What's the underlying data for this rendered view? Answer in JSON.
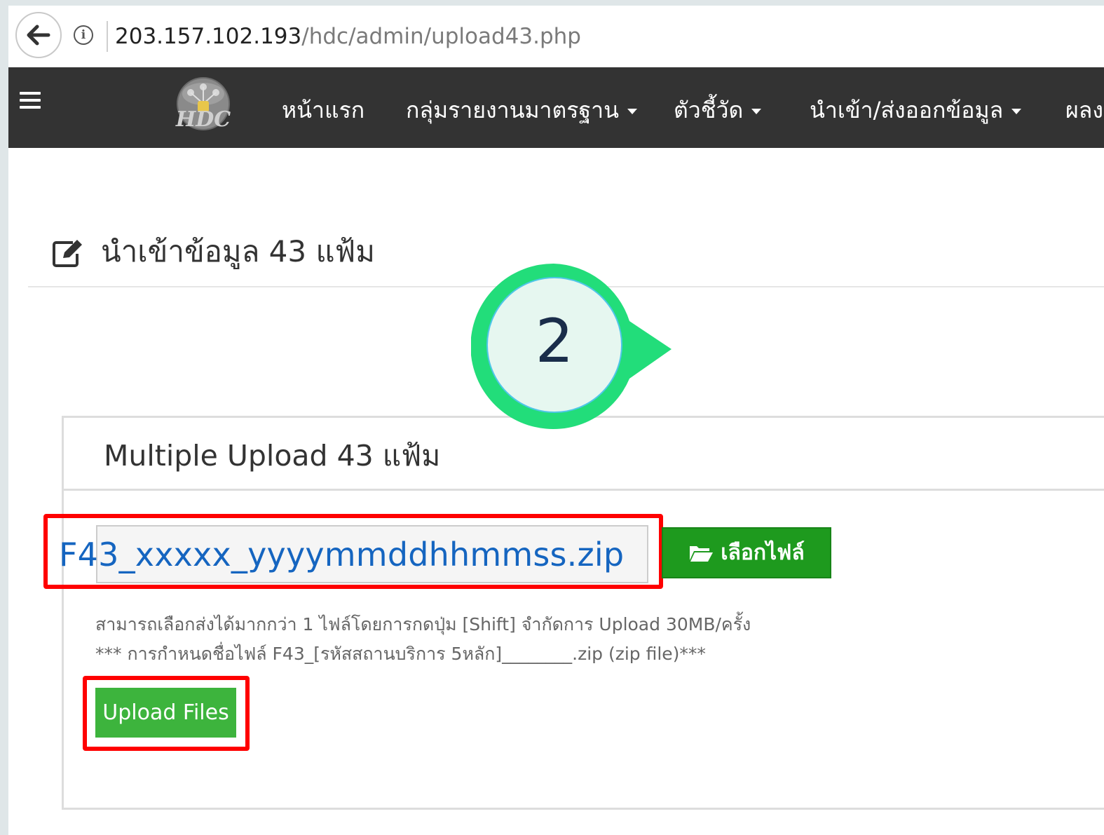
{
  "browser": {
    "url_host": "203.157.102.193",
    "url_path": "/hdc/admin/upload43.php"
  },
  "navbar": {
    "items": [
      {
        "label": "หน้าแรก",
        "dropdown": false
      },
      {
        "label": "กลุ่มรายงานมาตรฐาน",
        "dropdown": true
      },
      {
        "label": "ตัวชี้วัด",
        "dropdown": true
      },
      {
        "label": "นำเข้า/ส่งออกข้อมูล",
        "dropdown": true
      },
      {
        "label": "ผลง",
        "dropdown": false
      }
    ],
    "logo_text": "HDC"
  },
  "page": {
    "title": "นำเข้าข้อมูล 43 แฟ้ม"
  },
  "panel": {
    "title": "Multiple Upload 43 แฟ้ม",
    "file_name": "F43_xxxxx_yyyymmddhhmmss.zip",
    "choose_label": "เลือกไฟล์",
    "help_line1": "สามารถเลือกส่งได้มากกว่า 1 ไฟล์โดยการกดปุ่ม [Shift] จำกัดการ Upload 30MB/ครั้ง",
    "help_line2": "*** การกำหนดชื่อไฟล์ F43_[รหัสสถานบริการ 5หลัก]________.zip (zip file)***",
    "upload_label": "Upload Files"
  },
  "annotation": {
    "step_number": "2",
    "colors": {
      "highlight": "#ff0000",
      "callout_ring": "#22dd7a",
      "callout_fill": "#e6f7f0"
    }
  }
}
